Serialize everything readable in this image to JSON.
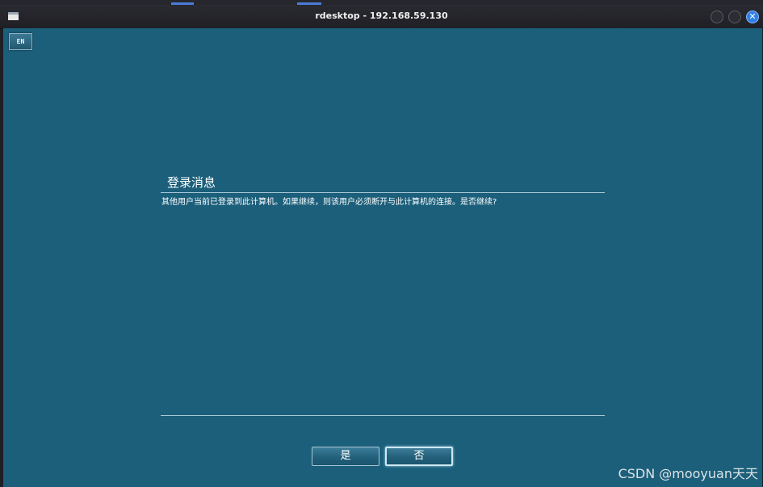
{
  "window": {
    "title": "rdesktop - 192.168.59.130",
    "close_glyph": "✕"
  },
  "remote": {
    "lang_button": "EN",
    "dialog": {
      "title": "登录消息",
      "message": "其他用户当前已登录到此计算机。如果继续，则该用户必须断开与此计算机的连接。是否继续?",
      "yes_label": "是",
      "no_label": "否"
    },
    "watermark": "CSDN @mooyuan天天"
  },
  "colors": {
    "desktop_bg": "#1b5f7b",
    "titlebar_bg": "#1f1f25",
    "close_button": "#2f7fe6"
  },
  "icons": {
    "app": "window-icon",
    "close": "close-icon"
  }
}
